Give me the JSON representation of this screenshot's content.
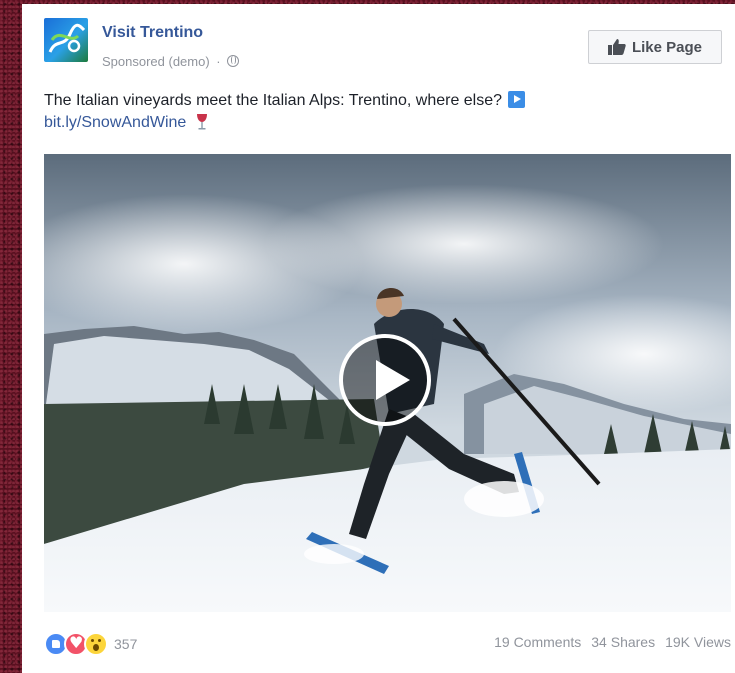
{
  "page": {
    "name": "Visit Trentino",
    "sponsored_label": "Sponsored (demo)",
    "separator": "·",
    "like_button_label": "Like Page"
  },
  "post": {
    "text": "The Italian vineyards meet the Italian Alps: Trentino, where else?",
    "link": "bit.ly/SnowAndWine"
  },
  "video": {
    "play_icon": "play-icon"
  },
  "footer": {
    "reaction_icons": [
      "like-reaction-icon",
      "love-reaction-icon",
      "wow-reaction-icon"
    ],
    "reactions_count": "357",
    "comments": "19 Comments",
    "shares": "34 Shares",
    "views": "19K Views"
  },
  "colors": {
    "link": "#365899",
    "text": "#1d2129",
    "muted": "#90949c",
    "background": "#5a1020"
  }
}
